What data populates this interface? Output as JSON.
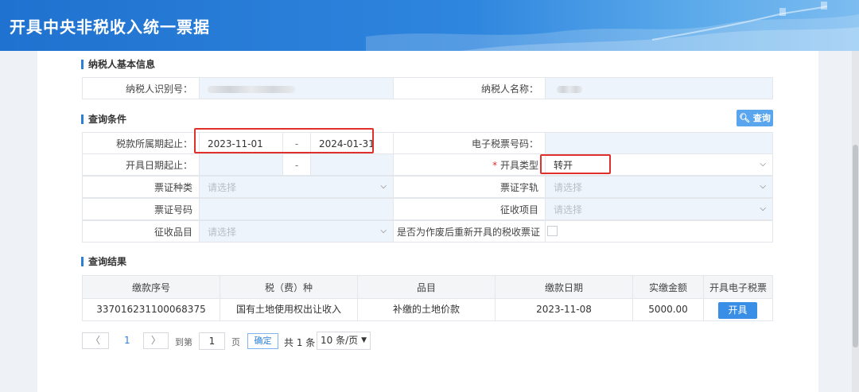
{
  "header": {
    "title": "开具中央非税收入统一票据"
  },
  "taxpayer_info": {
    "section_title": "纳税人基本信息",
    "id_label": "纳税人识别号：",
    "name_label": "纳税人名称："
  },
  "query": {
    "section_title": "查询条件",
    "search_button": "查询",
    "tax_period_label": "税款所属期起止：",
    "tax_period_start": "2023-11-01",
    "range_separator": "-",
    "tax_period_end": "2024-01-31",
    "e_ticket_no_label": "电子税票号码：",
    "issue_date_label": "开具日期起止：",
    "required_mark": "*",
    "issue_type_label": "开具类型",
    "issue_type_value": "转开",
    "ticket_kind_label": "票证种类",
    "ticket_kind_placeholder": "请选择",
    "ticket_track_label": "票证字轨",
    "ticket_track_placeholder": "请选择",
    "ticket_no_label": "票证号码",
    "collect_item_label": "征收项目",
    "collect_item_placeholder": "请选择",
    "collect_sub_label": "征收品目",
    "collect_sub_placeholder": "请选择",
    "reissue_label": "是否为作废后重新开具的税收票证"
  },
  "results": {
    "section_title": "查询结果",
    "columns": [
      "缴款序号",
      "税（费）种",
      "品目",
      "缴款日期",
      "实缴金额",
      "开具电子税票"
    ],
    "rows": [
      {
        "serial": "337016231100068375",
        "tax_type": "国有土地使用权出让收入",
        "item": "补缴的土地价款",
        "pay_date": "2023-11-08",
        "amount": "5000.00",
        "action": "开具"
      }
    ]
  },
  "pagination": {
    "prev": "〈",
    "current_page": "1",
    "next": "〉",
    "goto_label": "到第",
    "goto_value": "1",
    "page_unit": "页",
    "confirm": "确定",
    "total": "共 1 条",
    "page_size": "10 条/页"
  }
}
